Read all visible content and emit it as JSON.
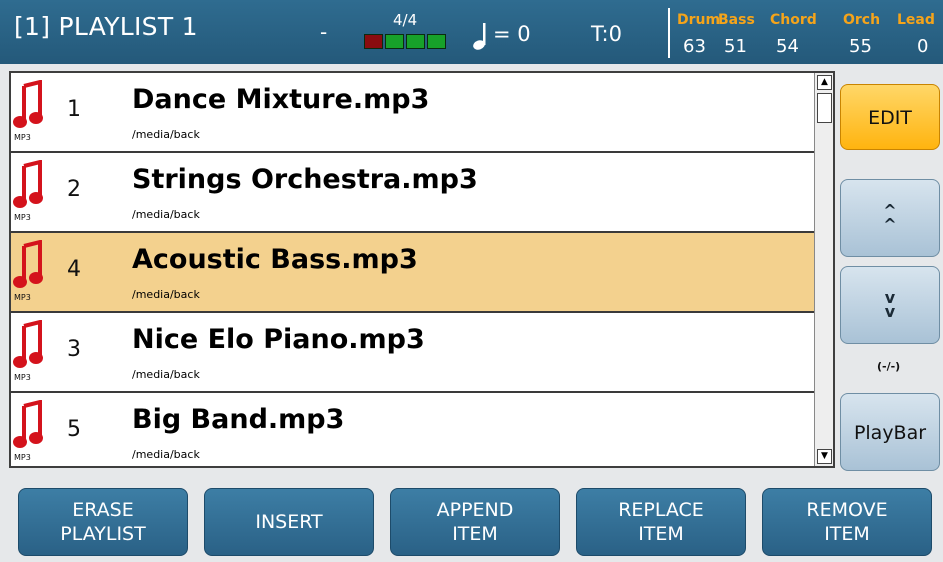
{
  "header": {
    "title": "[1] PLAYLIST 1",
    "dash": "-",
    "time_signature": "4/4",
    "meter_cells": [
      "red",
      "green",
      "green",
      "green"
    ],
    "tempo": "= 0",
    "transpose": "T:0",
    "volumes": [
      {
        "label": "Drum",
        "value": "63"
      },
      {
        "label": "Bass",
        "value": "51"
      },
      {
        "label": "Chord",
        "value": "54"
      },
      {
        "label": "Orch",
        "value": "55"
      },
      {
        "label": "Lead",
        "value": "0"
      }
    ]
  },
  "playlist": {
    "icon_label": "MP3",
    "items": [
      {
        "number": "1",
        "title": "Dance Mixture.mp3",
        "path": "/media/back",
        "selected": false
      },
      {
        "number": "2",
        "title": "Strings Orchestra.mp3",
        "path": "/media/back",
        "selected": false
      },
      {
        "number": "4",
        "title": "Acoustic Bass.mp3",
        "path": "/media/back",
        "selected": true
      },
      {
        "number": "3",
        "title": "Nice Elo Piano.mp3",
        "path": "/media/back",
        "selected": false
      },
      {
        "number": "5",
        "title": "Big Band.mp3",
        "path": "/media/back",
        "selected": false
      }
    ]
  },
  "right_panel": {
    "edit_label": "EDIT",
    "move_up_label": "^\n^",
    "move_down_label": "v\nv",
    "position_label": "(-/-)",
    "playbar_label": "PlayBar"
  },
  "bottom_buttons": [
    {
      "line1": "ERASE",
      "line2": "PLAYLIST"
    },
    {
      "line1": "INSERT",
      "line2": ""
    },
    {
      "line1": "APPEND",
      "line2": "ITEM"
    },
    {
      "line1": "REPLACE",
      "line2": "ITEM"
    },
    {
      "line1": "REMOVE",
      "line2": "ITEM"
    }
  ],
  "colors": {
    "header_bg": "#2a6486",
    "volume_label": "#f5a41a",
    "selected_row": "#f3d18e",
    "edit_button": "#ffc22c",
    "bottom_button": "#2f6c92",
    "mp3_icon": "#d4131c"
  }
}
